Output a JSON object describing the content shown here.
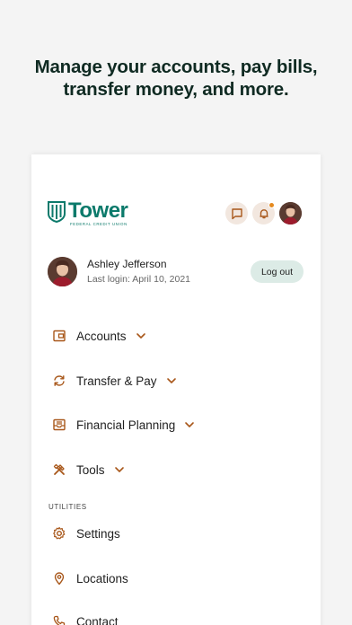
{
  "headline": {
    "line1": "Manage your accounts, pay bills,",
    "line2": "transfer money, and more."
  },
  "logo": {
    "name": "Tower",
    "subtitle": "FEDERAL CREDIT UNION"
  },
  "colors": {
    "brand": "#0c7a6b",
    "accent": "#b5651d",
    "icon_bg": "#f2e7df",
    "notification": "#e58a1f",
    "logout_bg": "#dcebe6"
  },
  "header_icons": [
    "message-icon",
    "bell-icon",
    "user-avatar"
  ],
  "profile": {
    "name": "Ashley Jefferson",
    "last_login": "Last login: April 10, 2021",
    "logout_label": "Log out"
  },
  "menu": {
    "accounts": "Accounts",
    "transfer": "Transfer & Pay",
    "planning": "Financial Planning",
    "tools": "Tools"
  },
  "utilities": {
    "section_label": "UTILITIES",
    "settings": "Settings",
    "locations": "Locations",
    "contact": "Contact"
  }
}
